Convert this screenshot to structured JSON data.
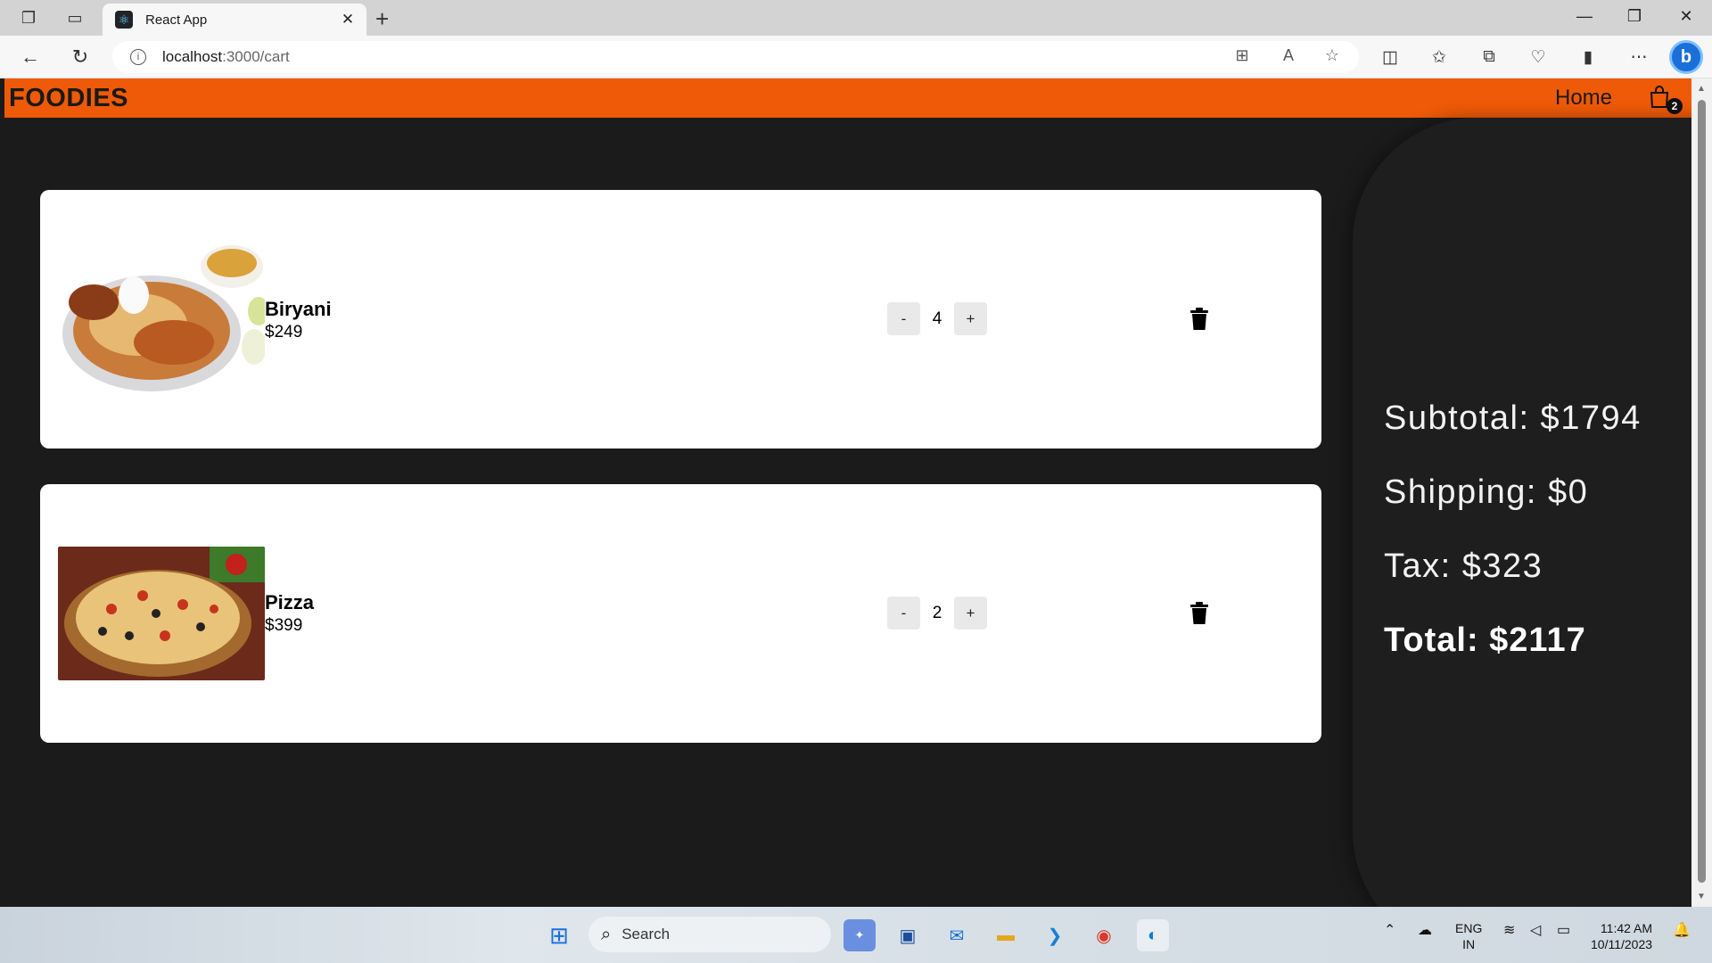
{
  "browser": {
    "tab_title": "React App",
    "url_host": "localhost",
    "url_path": ":3000/cart"
  },
  "app": {
    "logo": "FOODIES",
    "nav_home": "Home",
    "cart_count": "2"
  },
  "cart": {
    "items": [
      {
        "name": "Biryani",
        "price": "$249",
        "quantity": "4",
        "minus": "-",
        "plus": "+"
      },
      {
        "name": "Pizza",
        "price": "$399",
        "quantity": "2",
        "minus": "-",
        "plus": "+"
      }
    ]
  },
  "summary": {
    "subtotal": "Subtotal: $1794",
    "shipping": "Shipping: $0",
    "tax": "Tax: $323",
    "total": "Total: $2117"
  },
  "taskbar": {
    "search_placeholder": "Search",
    "lang_top": "ENG",
    "lang_bottom": "IN",
    "time": "11:42 AM",
    "date": "10/11/2023"
  },
  "colors": {
    "header": "#ee5a07",
    "page_bg": "#1b1b1b",
    "card_bg": "#ffffff"
  }
}
